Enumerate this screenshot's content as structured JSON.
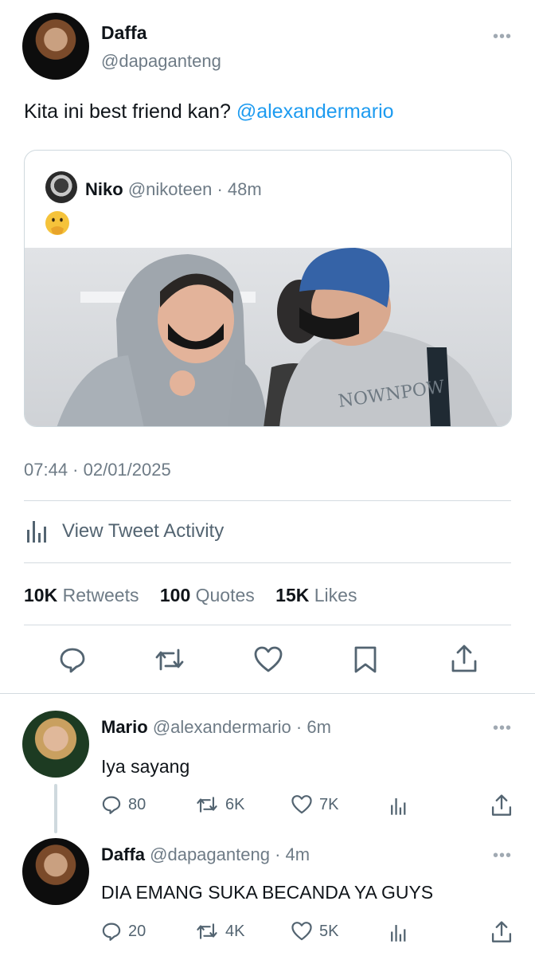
{
  "tweet": {
    "author_name": "Daffa",
    "author_handle": "@dapaganteng",
    "text_prefix": "Kita ini best friend kan?",
    "mention": "@alexandermario",
    "timestamp": "07:44 · 02/01/2025",
    "activity_label": "View Tweet Activity",
    "stats": {
      "retweets_count": "10K",
      "retweets_label": "Retweets",
      "quotes_count": "100",
      "quotes_label": "Quotes",
      "likes_count": "15K",
      "likes_label": "Likes"
    },
    "quoted": {
      "author_name": "Niko",
      "author_handle": "@nikoteen",
      "time": "· 48m",
      "emoji": "🫢"
    }
  },
  "replies": [
    {
      "author_name": "Mario",
      "author_handle": "@alexandermario",
      "time": "· 6m",
      "text": "Iya sayang",
      "replies": "80",
      "retweets": "6K",
      "likes": "7K"
    },
    {
      "author_name": "Daffa",
      "author_handle": "@dapaganteng",
      "time": "· 4m",
      "text": "DIA EMANG SUKA BECANDA YA GUYS",
      "replies": "20",
      "retweets": "4K",
      "likes": "5K"
    }
  ],
  "icons": [
    "more-icon",
    "reply-icon",
    "retweet-icon",
    "like-icon",
    "bookmark-icon",
    "share-icon",
    "analytics-icon"
  ],
  "colors": {
    "accent": "#1d9bf0",
    "secondary_text": "#6e7b86",
    "divider": "#d4dbe0"
  }
}
